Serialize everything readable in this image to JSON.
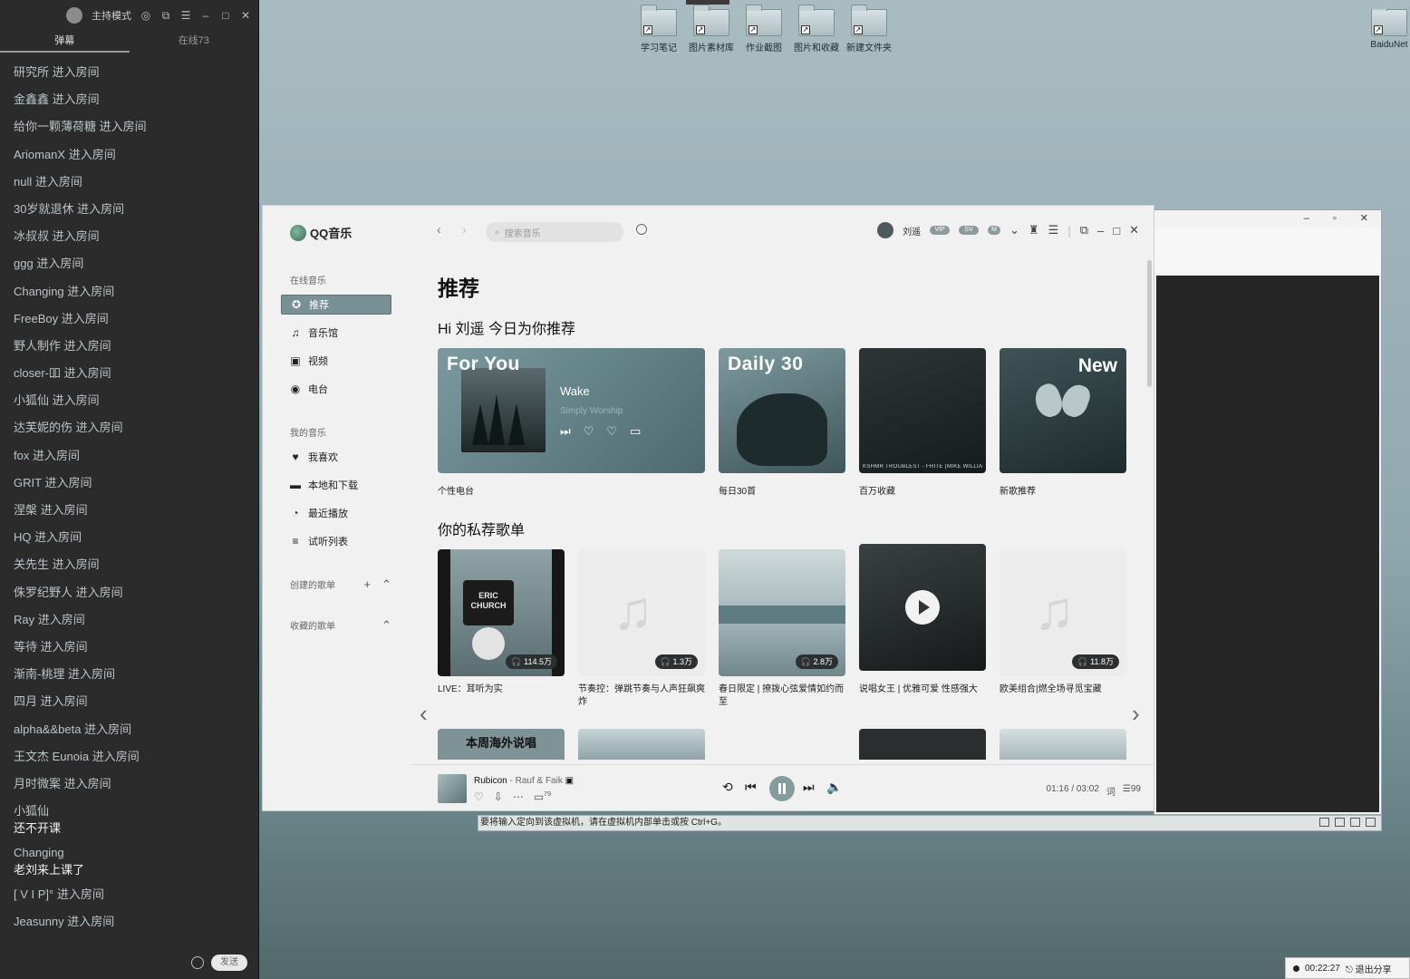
{
  "desktop": {
    "icons": [
      {
        "label": "学习笔记"
      },
      {
        "label": "图片素材库"
      },
      {
        "label": "作业截图"
      },
      {
        "label": "图片和收藏"
      },
      {
        "label": "新建文件夹"
      }
    ],
    "right_icon_label": "BaiduNet"
  },
  "chat": {
    "mode_label": "主持模式",
    "tabs": [
      "弹幕",
      "在线73"
    ],
    "messages": [
      {
        "user": "研究所",
        "action": "进入房间"
      },
      {
        "user": "金鑫鑫",
        "action": "进入房间"
      },
      {
        "user": "给你一颗薄荷糖",
        "action": "进入房间"
      },
      {
        "user": "AriomanX",
        "action": "进入房间"
      },
      {
        "user": "null",
        "action": "进入房间"
      },
      {
        "user": "30岁就退休",
        "action": "进入房间"
      },
      {
        "user": "冰叔叔",
        "action": "进入房间"
      },
      {
        "user": "ggg",
        "action": "进入房间"
      },
      {
        "user": "Changing",
        "action": "进入房间"
      },
      {
        "user": "FreeBoy",
        "action": "进入房间"
      },
      {
        "user": "野人制作",
        "action": "进入房间"
      },
      {
        "user": "closer-吅",
        "action": "进入房间"
      },
      {
        "user": "小狐仙",
        "action": "进入房间"
      },
      {
        "user": "达芙妮的伤",
        "action": "进入房间"
      },
      {
        "user": "fox",
        "action": "进入房间"
      },
      {
        "user": "GRIT",
        "action": "进入房间"
      },
      {
        "user": "涅槃",
        "action": "进入房间"
      },
      {
        "user": "HQ",
        "action": "进入房间"
      },
      {
        "user": "关先生",
        "action": "进入房间"
      },
      {
        "user": "侏罗纪野人",
        "action": "进入房间"
      },
      {
        "user": "Ray",
        "action": "进入房间"
      },
      {
        "user": "等待",
        "action": "进入房间"
      },
      {
        "user": "渐南-桃理",
        "action": "进入房间"
      },
      {
        "user": "四月",
        "action": "进入房间"
      },
      {
        "user": "alpha&&beta",
        "action": "进入房间"
      },
      {
        "user": "王文杰 Eunoia",
        "action": "进入房间"
      },
      {
        "user": "月时微案",
        "action": "进入房间"
      }
    ],
    "chat_messages": [
      {
        "user": "小狐仙",
        "text": "还不开课"
      },
      {
        "user": "Changing",
        "text": "老刘来上课了"
      }
    ],
    "tail_messages": [
      {
        "user": "[ V I P]°",
        "action": "进入房间"
      },
      {
        "user": "Jeasunny",
        "action": "进入房间"
      }
    ],
    "send_label": "发送"
  },
  "qq": {
    "app_name": "QQ音乐",
    "search_placeholder": "搜索音乐",
    "user_name": "刘遥",
    "sidebar": {
      "online_section": "在线音乐",
      "online_items": [
        {
          "label": "推荐",
          "icon": "recommend-icon"
        },
        {
          "label": "音乐馆",
          "icon": "music-note-icon"
        },
        {
          "label": "视频",
          "icon": "video-icon"
        },
        {
          "label": "电台",
          "icon": "radio-icon"
        }
      ],
      "my_section": "我的音乐",
      "my_items": [
        {
          "label": "我喜欢",
          "icon": "heart-icon"
        },
        {
          "label": "本地和下载",
          "icon": "monitor-icon"
        },
        {
          "label": "最近播放",
          "icon": "clock-icon"
        },
        {
          "label": "试听列表",
          "icon": "playlist-icon"
        }
      ],
      "created_playlists": "创建的歌单",
      "collected_playlists": "收藏的歌单"
    },
    "page_title": "推荐",
    "greeting": "Hi 刘遥 今日为你推荐",
    "featured": [
      {
        "badge": "For You",
        "song": "Wake",
        "artist": "Simply Worship",
        "caption": "个性电台"
      },
      {
        "badge": "Daily 30",
        "caption": "每日30首"
      },
      {
        "strip": "KSHMR TROUBLEST - FRITE (MIKE WILLIAMS REMIX)",
        "caption": "百万收藏"
      },
      {
        "badge": "New",
        "caption": "新歌推荐"
      }
    ],
    "playlist_section": "你的私荐歌单",
    "playlists": [
      {
        "count": "114.5万",
        "caption": "LIVE：耳听为实",
        "art_text": "ERIC CHURCH"
      },
      {
        "count": "1.3万",
        "caption": "节奏控：弹跳节奏与人声狂飙爽炸"
      },
      {
        "count": "2.8万",
        "caption": "春日限定 | 撩拨心弦爱情如约而至"
      },
      {
        "count": "",
        "caption": "说唱女王 | 优雅可爱 性感强大"
      },
      {
        "count": "11.8万",
        "caption": "欧美组合|燃全场寻觅宝藏"
      }
    ],
    "row2_first_text": "本周海外说唱",
    "player": {
      "title": "Rubicon",
      "artist": "Rauf & Faik",
      "comment_count": "79",
      "time": "01:16 / 03:02",
      "lyric_label": "词",
      "queue_count": "99"
    }
  },
  "vm": {
    "status_text": "要将输入定向到该虚拟机，请在虚拟机内部单击或按 Ctrl+G。"
  },
  "share": {
    "timer": "00:22:27",
    "exit_label": "退出分享"
  }
}
